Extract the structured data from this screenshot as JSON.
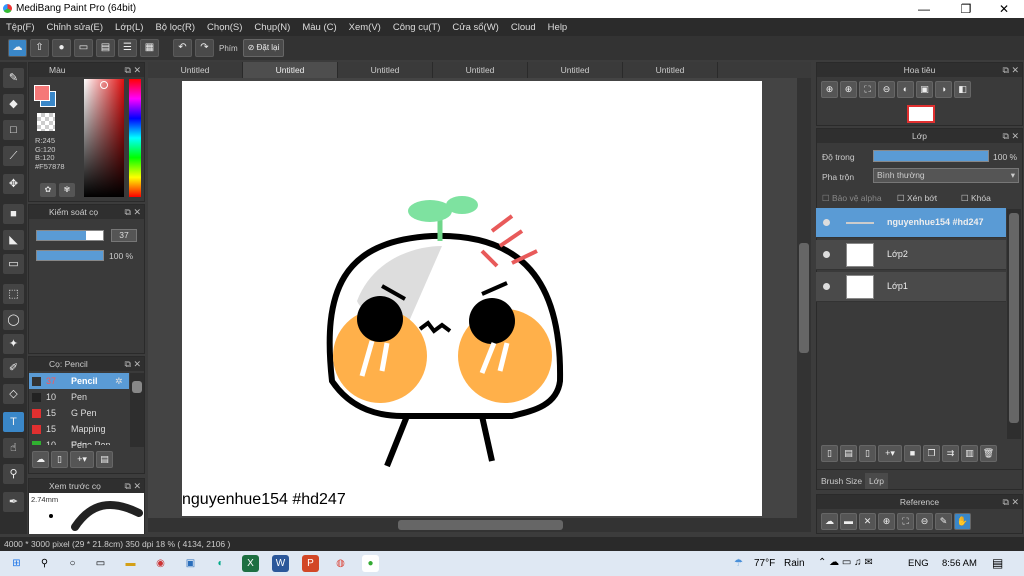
{
  "app": {
    "title": "MediBang Paint Pro (64bit)",
    "win_min": "—",
    "win_max": "❐",
    "win_close": "✕"
  },
  "menu": [
    "Tệp(F)",
    "Chỉnh sửa(E)",
    "Lớp(L)",
    "Bộ lọc(R)",
    "Chọn(S)",
    "Chụp(N)",
    "Màu (C)",
    "Xem(V)",
    "Công cụ(T)",
    "Cửa sổ(W)",
    "Cloud",
    "Help"
  ],
  "toolbar": {
    "key_label": "Phím",
    "reset_label": "Đặt lại"
  },
  "color_panel": {
    "title": "Màu",
    "r": "R:245",
    "g": "G:120",
    "b": "B:120",
    "hex": "#F57878",
    "primary_color": "#F57878",
    "secondary_color": "#3a87c8"
  },
  "brush_control": {
    "title": "Kiểm soát cọ",
    "size_value": "37",
    "opacity_value": "100 %",
    "size_fill": 0.37,
    "opacity_fill": 1.0
  },
  "brush_list": {
    "title": "Cọ: Pencil",
    "items": [
      {
        "size": "37",
        "name": "Pencil",
        "color": "#333333",
        "selected": true
      },
      {
        "size": "10",
        "name": "Pen",
        "color": "#222222"
      },
      {
        "size": "15",
        "name": "G Pen",
        "color": "#e03030"
      },
      {
        "size": "15",
        "name": "Mapping Pen",
        "color": "#e03030"
      },
      {
        "size": "10",
        "name": "Edge Pen",
        "color": "#30b030"
      }
    ]
  },
  "brush_preview": {
    "title": "Xem trước cọ",
    "size_text": "2.74mm"
  },
  "tabs": [
    "Untitled",
    "Untitled",
    "Untitled",
    "Untitled",
    "Untitled",
    "Untitled"
  ],
  "canvas": {
    "signature": "nguyenhue154   #hd247"
  },
  "navigator": {
    "title": "Hoa tiêu"
  },
  "layer_panel": {
    "title": "Lớp",
    "opacity_label": "Độ trong",
    "opacity_value": "100 %",
    "blend_label": "Pha trộn",
    "blend_value": "Bình thường",
    "protect_alpha": "Bảo vệ alpha",
    "clipping": "Xén bớt",
    "lock": "Khóa",
    "layers": [
      {
        "name": "nguyenhue154   #hd247",
        "selected": true
      },
      {
        "name": "Lớp2",
        "selected": false
      },
      {
        "name": "Lớp1",
        "selected": false
      }
    ],
    "tab_brush_size": "Brush Size",
    "tab_layer": "Lớp"
  },
  "reference": {
    "title": "Reference"
  },
  "status": {
    "text": "4000 * 3000 pixel  (29 * 21.8cm)  350 dpi  18 %  ( 4134, 2106 )"
  },
  "taskbar": {
    "weather_temp": "77°F",
    "weather_text": "Rain",
    "lang": "ENG",
    "time": "8:56 AM"
  }
}
